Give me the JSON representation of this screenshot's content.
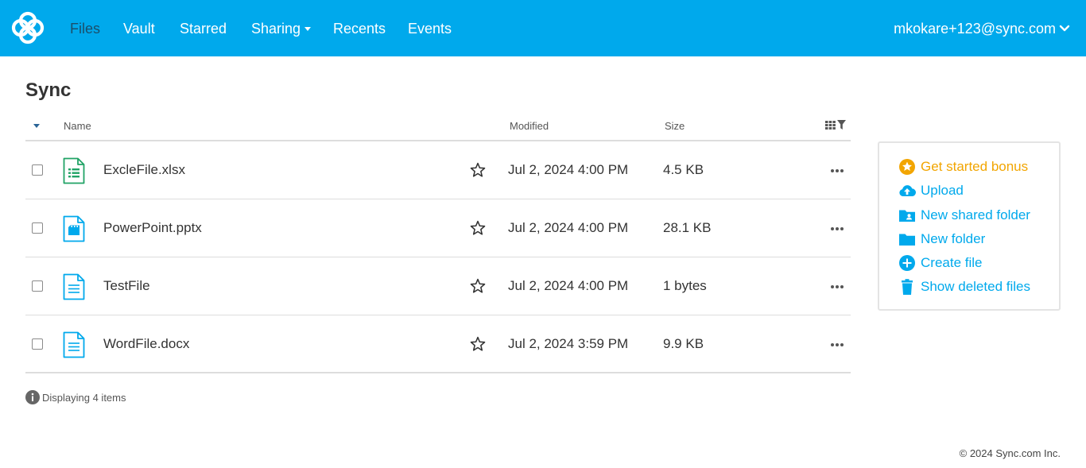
{
  "nav": {
    "items": [
      {
        "label": "Files",
        "active": true
      },
      {
        "label": "Vault"
      },
      {
        "label": "Starred"
      },
      {
        "label": "Sharing"
      },
      {
        "label": "Recents"
      },
      {
        "label": "Events"
      }
    ],
    "user_email": "mkokare+123@sync.com"
  },
  "page": {
    "title": "Sync"
  },
  "table": {
    "columns": {
      "name": "Name",
      "modified": "Modified",
      "size": "Size"
    },
    "rows": [
      {
        "name": "ExcleFile.xlsx",
        "icon": "spreadsheet-file-icon",
        "modified": "Jul 2, 2024 4:00 PM",
        "size": "4.5 KB"
      },
      {
        "name": "PowerPoint.pptx",
        "icon": "presentation-file-icon",
        "modified": "Jul 2, 2024 4:00 PM",
        "size": "28.1 KB"
      },
      {
        "name": "TestFile",
        "icon": "text-file-icon",
        "modified": "Jul 2, 2024 4:00 PM",
        "size": "1 bytes"
      },
      {
        "name": "WordFile.docx",
        "icon": "document-file-icon",
        "modified": "Jul 2, 2024 3:59 PM",
        "size": "9.9 KB"
      }
    ],
    "footer": "Displaying 4 items"
  },
  "side_panel": {
    "actions": [
      {
        "label": "Get started bonus",
        "icon": "star-badge-icon"
      },
      {
        "label": "Upload",
        "icon": "cloud-upload-icon"
      },
      {
        "label": "New shared folder",
        "icon": "shared-folder-icon"
      },
      {
        "label": "New folder",
        "icon": "folder-icon"
      },
      {
        "label": "Create file",
        "icon": "plus-circle-icon"
      },
      {
        "label": "Show deleted files",
        "icon": "trash-icon"
      }
    ]
  },
  "copyright": "© 2024 Sync.com Inc.",
  "colors": {
    "brand": "#00a9ec",
    "bonus": "#f2a500",
    "excel": "#21a366",
    "text": "#333333"
  }
}
